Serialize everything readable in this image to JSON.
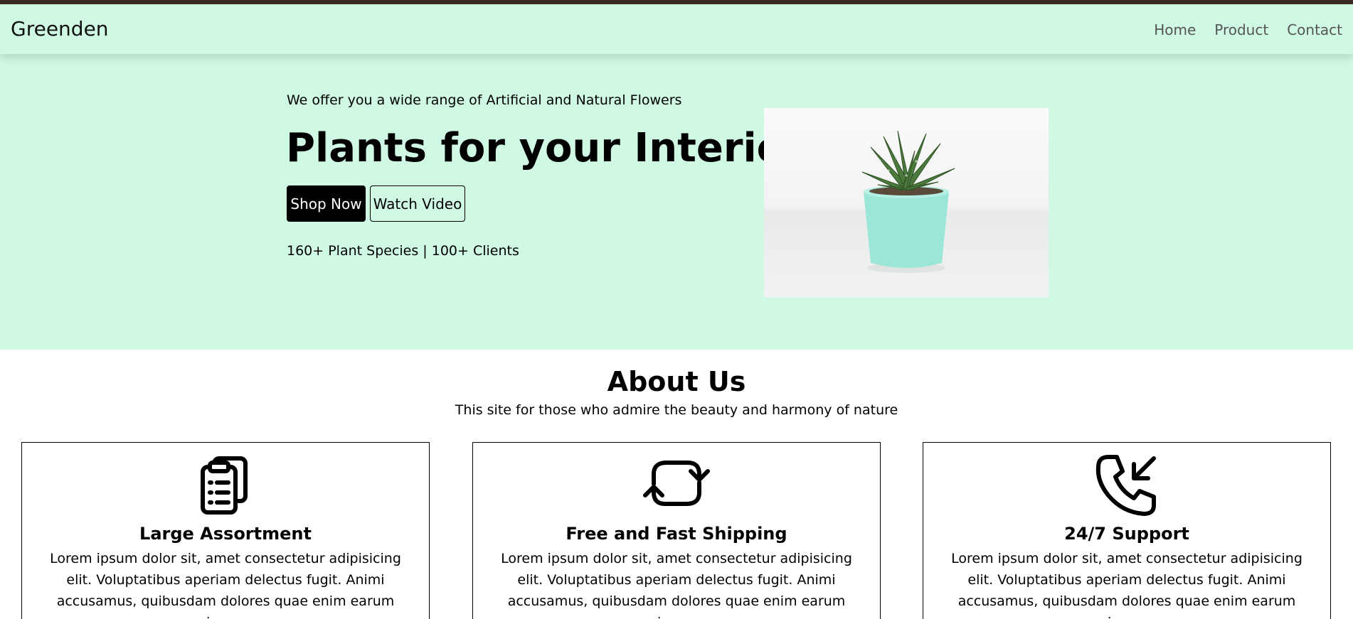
{
  "brand": "Greenden",
  "nav": {
    "home": "Home",
    "product": "Product",
    "contact": "Contact"
  },
  "hero": {
    "tagline": "We offer you a wide range of Artificial and Natural Flowers",
    "title": "Plants for your Interior",
    "shop_button": "Shop Now",
    "video_button": "Watch Video",
    "stats": "160+ Plant Species | 100+ Clients"
  },
  "about": {
    "title": "About Us",
    "subtitle": "This site for those who admire the beauty and harmony of nature",
    "cards": [
      {
        "icon": "clipboard-list-icon",
        "title": "Large Assortment",
        "text": "Lorem ipsum dolor sit, amet consectetur adipisicing elit. Voluptatibus aperiam delectus fugit. Animi accusamus, quibusdam dolores quae enim earum magni numquam"
      },
      {
        "icon": "refresh-icon",
        "title": "Free and Fast Shipping",
        "text": "Lorem ipsum dolor sit, amet consectetur adipisicing elit. Voluptatibus aperiam delectus fugit. Animi accusamus, quibusdam dolores quae enim earum magni numquam"
      },
      {
        "icon": "phone-incoming-icon",
        "title": "24/7 Support",
        "text": "Lorem ipsum dolor sit, amet consectetur adipisicing elit. Voluptatibus aperiam delectus fugit. Animi accusamus, quibusdam dolores quae enim earum magni numquam"
      }
    ]
  },
  "colors": {
    "accent": "#cff9e3",
    "top_line": "#3b2a22"
  }
}
